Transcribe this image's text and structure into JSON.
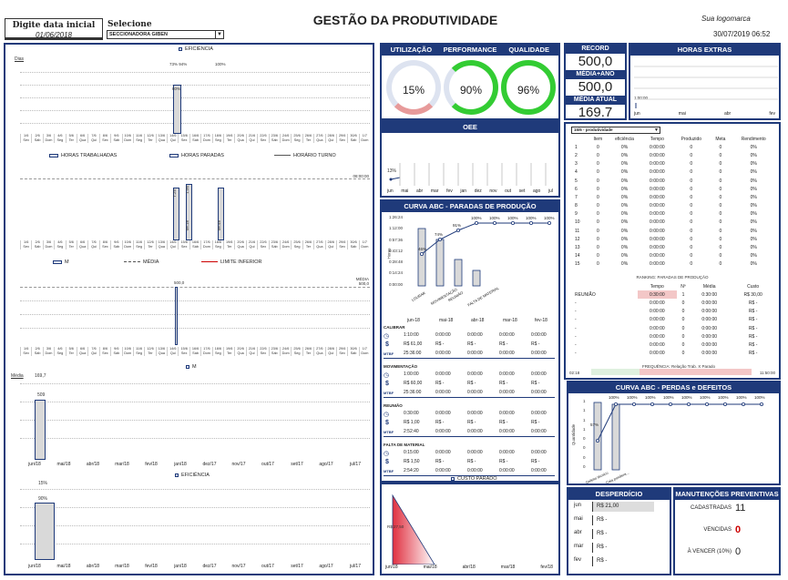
{
  "header": {
    "date_label": "Digite data inicial",
    "date_value": "01/06/2018",
    "select_label": "Selecione",
    "select_value": "SECCIONADORA GIBEN",
    "title": "GESTÃO DA PRODUTIVIDADE",
    "logo_text": "Sua logomarca",
    "datetime": "30/07/2019 06:52"
  },
  "left": {
    "chart1": {
      "legend_top": "EFICIÊNCIA",
      "axis_label": "Dias",
      "top_labels": [
        "73% 94%",
        "100%"
      ],
      "bar_label": "80%",
      "legend": [
        "HORAS TRABALHADAS",
        "HORAS PARADAS",
        "HORÁRIO TURNO"
      ]
    },
    "chart2": {
      "right_label": "08:00:00",
      "bars": [
        "7:25",
        "1:00",
        "00:25"
      ],
      "bar_labels": [
        "08:18",
        "08:48"
      ],
      "legend": [
        "M",
        "MÉDIA",
        "LIMITE INFERIOR"
      ]
    },
    "chart3": {
      "right_label": "MÉDIA\n500,0",
      "top_value": "500,0"
    },
    "chart4": {
      "legend": "M",
      "media_label": "Média",
      "media_value": "169,7",
      "bar_value": "509"
    },
    "chart5": {
      "legend": "EFICIÊNCIA",
      "top_value": "15%",
      "bar_value": "90%"
    },
    "day_labels": [
      [
        "1/6",
        "Sex"
      ],
      [
        "2/6",
        "Sáb"
      ],
      [
        "3/6",
        "Dom"
      ],
      [
        "4/6",
        "Seg"
      ],
      [
        "5/6",
        "Ter"
      ],
      [
        "6/6",
        "Qua"
      ],
      [
        "7/6",
        "Qui"
      ],
      [
        "8/6",
        "Sex"
      ],
      [
        "9/6",
        "Sáb"
      ],
      [
        "10/6",
        "Dom"
      ],
      [
        "11/6",
        "Seg"
      ],
      [
        "12/6",
        "Ter"
      ],
      [
        "13/6",
        "Qua"
      ],
      [
        "14/6",
        "Qui"
      ],
      [
        "15/6",
        "Sex"
      ],
      [
        "16/6",
        "Sáb"
      ],
      [
        "17/6",
        "Dom"
      ],
      [
        "18/6",
        "Seg"
      ],
      [
        "19/6",
        "Ter"
      ],
      [
        "20/6",
        "Qua"
      ],
      [
        "21/6",
        "Qui"
      ],
      [
        "22/6",
        "Sex"
      ],
      [
        "23/6",
        "Sáb"
      ],
      [
        "24/6",
        "Dom"
      ],
      [
        "25/6",
        "Seg"
      ],
      [
        "26/6",
        "Ter"
      ],
      [
        "27/6",
        "Qua"
      ],
      [
        "28/6",
        "Qui"
      ],
      [
        "29/6",
        "Sex"
      ],
      [
        "30/6",
        "Sáb"
      ],
      [
        "1/7",
        "Dom"
      ]
    ],
    "month_labels": [
      "jun/18",
      "mai/18",
      "abr/18",
      "mar/18",
      "fev/18",
      "jan/18",
      "dez/17",
      "nov/17",
      "out/17",
      "set/17",
      "ago/17",
      "jul/17"
    ]
  },
  "middle": {
    "gauges": [
      {
        "label": "UTILIZAÇÃO",
        "value": "15%",
        "color": "#e79a9a"
      },
      {
        "label": "PERFORMANCE",
        "value": "90%",
        "color": "#33cc33"
      },
      {
        "label": "QUALIDADE",
        "value": "96%",
        "color": "#33cc33"
      }
    ],
    "oee": {
      "title": "OEE",
      "value": "13%",
      "months": [
        "jun",
        "mai",
        "abr",
        "mar",
        "fev",
        "jan",
        "dez",
        "nov",
        "out",
        "set",
        "ago",
        "jul"
      ]
    },
    "abc_paradas": {
      "title": "CURVA ABC - PARADAS DE PRODUÇÃO",
      "y_ticks": [
        "1:26:24",
        "1:12:00",
        "0:57:36",
        "0:43:12",
        "0:28:48",
        "0:14:24",
        "0:00:00"
      ],
      "y_label": "Horas",
      "pct_labels": [
        "46%",
        "74%",
        "91%",
        "100%",
        "100%",
        "100%",
        "100%",
        "100%"
      ],
      "categories": [
        "LOURAR",
        "MOVIMENTAÇÃO",
        "REUNIÃO",
        "FALTA DE MATERIAL"
      ]
    },
    "months_header": [
      "jun-18",
      "mai-18",
      "abr-18",
      "mar-18",
      "fev-18"
    ],
    "stop_blocks": [
      {
        "name": "CALIBRAR",
        "time": [
          "1:10:00",
          "0:00:00",
          "0:00:00",
          "0:00:00",
          "0:00:00"
        ],
        "money": [
          "R$ 61,00",
          "R$ -",
          "R$ -",
          "R$ -",
          "R$ -"
        ],
        "mttr": [
          "25:36:00",
          "0:00:00",
          "0:00:00",
          "0:00:00",
          "0:00:00"
        ]
      },
      {
        "name": "MOVIMENTAÇÃO",
        "time": [
          "1:00:00",
          "0:00:00",
          "0:00:00",
          "0:00:00",
          "0:00:00"
        ],
        "money": [
          "R$ 60,00",
          "R$ -",
          "R$ -",
          "R$ -",
          "R$ -"
        ],
        "mttr": [
          "25:36:00",
          "0:00:00",
          "0:00:00",
          "0:00:00",
          "0:00:00"
        ]
      },
      {
        "name": "REUNIÃO",
        "time": [
          "0:30:00",
          "0:00:00",
          "0:00:00",
          "0:00:00",
          "0:00:00"
        ],
        "money": [
          "R$ 1,00",
          "R$ -",
          "R$ -",
          "R$ -",
          "R$ -"
        ],
        "mttr": [
          "2:52:40",
          "0:00:00",
          "0:00:00",
          "0:00:00",
          "0:00:00"
        ]
      },
      {
        "name": "FALTA DE MATERIAL",
        "time": [
          "0:15:00",
          "0:00:00",
          "0:00:00",
          "0:00:00",
          "0:00:00"
        ],
        "money": [
          "R$ 1,50",
          "R$ -",
          "R$ -",
          "R$ -",
          "R$ -"
        ],
        "mttr": [
          "2:54:20",
          "0:00:00",
          "0:00:00",
          "0:00:00",
          "0:00:00"
        ]
      }
    ],
    "mtbf_label": "MTBF",
    "custo_parado": {
      "legend": "CUSTO PARADO",
      "value": "R$ 27,50",
      "months": [
        "jun/18",
        "mai/18",
        "abr/18",
        "mar/18",
        "fev/18"
      ]
    }
  },
  "right": {
    "recorde": {
      "label": "RECORD",
      "value": "500,0"
    },
    "media_ano": {
      "label": "MÉDIA+ANO",
      "value": "500,0"
    },
    "media_atual": {
      "label": "MÉDIA ATUAL",
      "value": "169.7"
    },
    "horas_extras": {
      "title": "HORAS EXTRAS",
      "value": "1:00:00",
      "months": [
        "jun",
        "mai",
        "abr",
        "fev"
      ]
    },
    "table": {
      "select_value": "15/6 - produtividade",
      "headers": [
        "",
        "Item",
        "eficiência",
        "Tempo",
        "Produzido",
        "Meta",
        "Rendimento"
      ],
      "rows": [
        [
          "1",
          "0",
          "0%",
          "0:00:00",
          "0",
          "0",
          "0%"
        ],
        [
          "2",
          "0",
          "0%",
          "0:00:00",
          "0",
          "0",
          "0%"
        ],
        [
          "3",
          "0",
          "0%",
          "0:00:00",
          "0",
          "0",
          "0%"
        ],
        [
          "4",
          "0",
          "0%",
          "0:00:00",
          "0",
          "0",
          "0%"
        ],
        [
          "5",
          "0",
          "0%",
          "0:00:00",
          "0",
          "0",
          "0%"
        ],
        [
          "6",
          "0",
          "0%",
          "0:00:00",
          "0",
          "0",
          "0%"
        ],
        [
          "7",
          "0",
          "0%",
          "0:00:00",
          "0",
          "0",
          "0%"
        ],
        [
          "8",
          "0",
          "0%",
          "0:00:00",
          "0",
          "0",
          "0%"
        ],
        [
          "9",
          "0",
          "0%",
          "0:00:00",
          "0",
          "0",
          "0%"
        ],
        [
          "10",
          "0",
          "0%",
          "0:00:00",
          "0",
          "0",
          "0%"
        ],
        [
          "11",
          "0",
          "0%",
          "0:00:00",
          "0",
          "0",
          "0%"
        ],
        [
          "12",
          "0",
          "0%",
          "0:00:00",
          "0",
          "0",
          "0%"
        ],
        [
          "13",
          "0",
          "0%",
          "0:00:00",
          "0",
          "0",
          "0%"
        ],
        [
          "14",
          "0",
          "0%",
          "0:00:00",
          "0",
          "0",
          "0%"
        ],
        [
          "15",
          "0",
          "0%",
          "0:00:00",
          "0",
          "0",
          "0%"
        ]
      ]
    },
    "ranking": {
      "title": "RANKING: PARADAS DE PRODUÇÃO",
      "headers": [
        "",
        "Tempo",
        "Nº",
        "Média",
        "Custo"
      ],
      "rows": [
        [
          "REUNIÃO",
          "0:30:00",
          "1",
          "0:30:00",
          "R$ 30,00"
        ],
        [
          "-",
          "0:00:00",
          "0",
          "0:00:00",
          "R$ -"
        ],
        [
          "-",
          "0:00:00",
          "0",
          "0:00:00",
          "R$ -"
        ],
        [
          "-",
          "0:00:00",
          "0",
          "0:00:00",
          "R$ -"
        ],
        [
          "-",
          "0:00:00",
          "0",
          "0:00:00",
          "R$ -"
        ],
        [
          "-",
          "0:00:00",
          "0",
          "0:00:00",
          "R$ -"
        ],
        [
          "-",
          "0:00:00",
          "0",
          "0:00:00",
          "R$ -"
        ],
        [
          "-",
          "0:00:00",
          "0",
          "0:00:00",
          "R$ -"
        ]
      ],
      "footer_left": "02:18",
      "footer_mid": "FREQUÊNCIA: Relação Trab. X Parado",
      "footer_right": "11:50:00"
    },
    "abc_perdas": {
      "title": "CURVA ABC - PERDAS e DEFEITOS",
      "y_ticks": [
        "1",
        "1",
        "1",
        "1",
        "0",
        "0",
        "0",
        "0"
      ],
      "y_label": "Quantidade",
      "pct_labels": [
        "57%",
        "100%",
        "100%",
        "100%",
        "100%",
        "100%",
        "100%",
        "100%",
        "100%",
        "100%"
      ],
      "categories": [
        "Defeito técnico",
        "Cala pondera..."
      ]
    },
    "desperdicio": {
      "title": "DESPERDÍCIO",
      "rows": [
        [
          "jun",
          "R$ 21,00"
        ],
        [
          "mai",
          "R$ -"
        ],
        [
          "abr",
          "R$ -"
        ],
        [
          "mar",
          "R$ -"
        ],
        [
          "fev",
          "R$ -"
        ]
      ]
    },
    "manutencoes": {
      "title": "MANUTENÇÕES PREVENTIVAS",
      "rows": [
        [
          "CADASTRADAS",
          "11"
        ],
        [
          "VENCIDAS",
          "0"
        ],
        [
          "À VENCER (10%)",
          "0"
        ]
      ]
    }
  }
}
